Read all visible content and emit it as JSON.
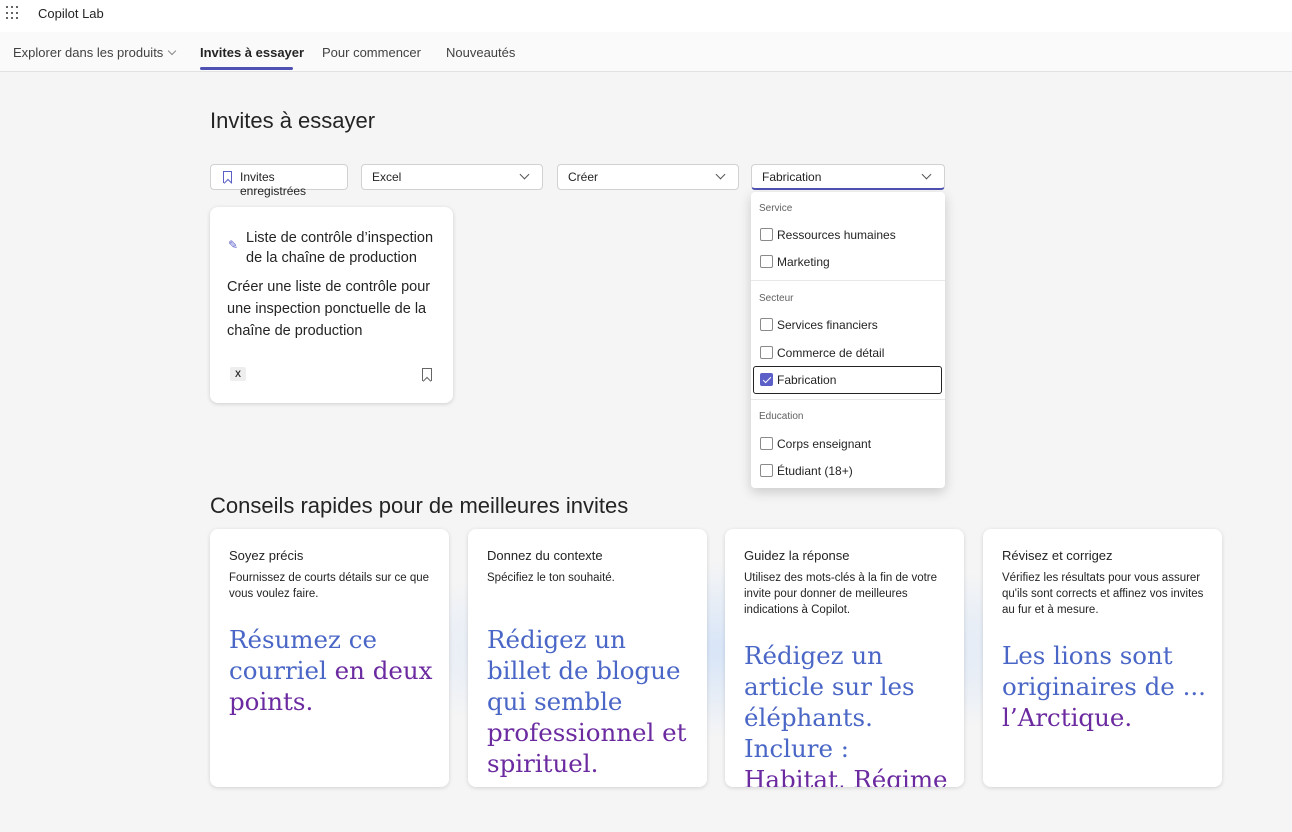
{
  "app": {
    "title": "Copilot Lab"
  },
  "nav": {
    "items": [
      {
        "label": "Explorer dans les produits"
      },
      {
        "label": "Invites à essayer"
      },
      {
        "label": "Pour commencer"
      },
      {
        "label": "Nouveautés"
      }
    ],
    "active": "Invites à essayer"
  },
  "prompts_section": {
    "title": "Invites à essayer"
  },
  "filters": {
    "saved": "Invites enregistrées",
    "app": "Excel",
    "action": "Créer",
    "job": "Fabrication"
  },
  "prompt_card": {
    "title": "Liste de contrôle d’inspection de la chaîne de production",
    "description": "Créer une liste de contrôle pour une inspection ponctuelle de la chaîne de production",
    "app_icon": "excel-icon"
  },
  "dropdown": {
    "groups": [
      {
        "label": "Service",
        "options": [
          {
            "label": "Ressources humaines",
            "checked": false
          },
          {
            "label": "Marketing",
            "checked": false
          }
        ]
      },
      {
        "label": "Secteur",
        "options": [
          {
            "label": "Services financiers",
            "checked": false
          },
          {
            "label": "Commerce de détail",
            "checked": false
          },
          {
            "label": "Fabrication",
            "checked": true
          }
        ]
      },
      {
        "label": "Education",
        "options": [
          {
            "label": "Corps enseignant",
            "checked": false
          },
          {
            "label": "Étudiant (18+)",
            "checked": false
          }
        ]
      }
    ]
  },
  "tips_section": {
    "title": "Conseils rapides pour de meilleures invites",
    "cards": [
      {
        "title": "Soyez précis",
        "description": "Fournissez de courts détails sur ce que vous voulez faire.",
        "example_parts": [
          "Résumez ce courriel ",
          "en deux points."
        ]
      },
      {
        "title": "Donnez du contexte",
        "description": "Spécifiez le ton souhaité.",
        "example_parts": [
          "Rédigez un billet de blogue qui semble ",
          "professionnel et spirituel."
        ]
      },
      {
        "title": "Guidez la réponse",
        "description": "Utilisez des mots-clés à la fin de votre invite pour donner de meilleures indications à Copilot.",
        "example_parts": [
          "Rédigez un article sur les éléphants. Inclure : ",
          "Habitat, Régime alimentaire"
        ]
      },
      {
        "title": "Révisez et corrigez",
        "description": "Vérifiez les résultats pour vous assurer qu'ils sont corrects et affinez vos invites au fur et à mesure.",
        "example_parts": [
          "Les lions sont originaires de ... ",
          "l’Arctique."
        ]
      }
    ]
  },
  "colors": {
    "accent": "#4f52b2",
    "example_blue": "#4a66c6",
    "example_purple": "#6b2aa0"
  }
}
